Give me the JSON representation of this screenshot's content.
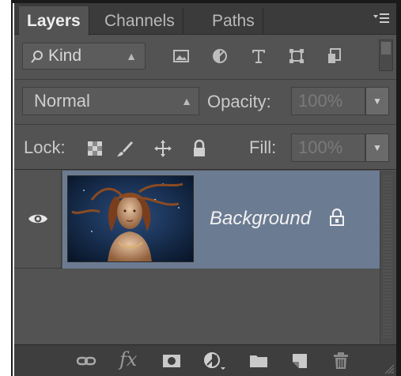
{
  "tabs": [
    {
      "label": "Layers",
      "active": true
    },
    {
      "label": "Channels",
      "active": false
    },
    {
      "label": "Paths",
      "active": false
    }
  ],
  "filter": {
    "kind_label": "Kind",
    "icons": [
      "image-filter-icon",
      "adjustment-filter-icon",
      "type-filter-icon",
      "shape-filter-icon",
      "smart-object-filter-icon"
    ]
  },
  "blend": {
    "mode": "Normal",
    "opacity_label": "Opacity:",
    "opacity_value": "100%"
  },
  "lock": {
    "label": "Lock:",
    "icons": [
      "lock-transparent-icon",
      "lock-image-icon",
      "lock-position-icon",
      "lock-all-icon"
    ],
    "fill_label": "Fill:",
    "fill_value": "100%"
  },
  "layers": [
    {
      "name": "Background",
      "visible": true,
      "locked": true
    }
  ],
  "bottom_toolbar": {
    "fx_label": "fx",
    "icons": [
      "link-layers-icon",
      "layer-style-icon",
      "add-mask-icon",
      "adjustment-layer-icon",
      "new-group-icon",
      "new-layer-icon",
      "delete-layer-icon"
    ]
  },
  "colors": {
    "panel": "#535353",
    "tabbar": "#3b3b3b",
    "selected_layer": "#6b7b92"
  }
}
